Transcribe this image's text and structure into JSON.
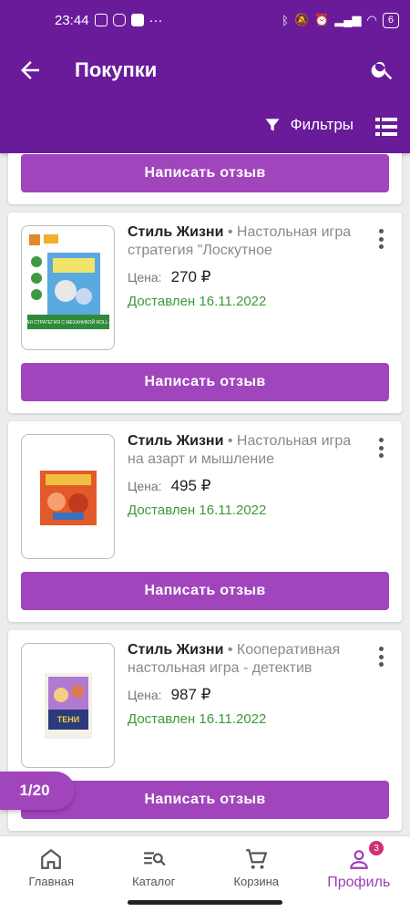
{
  "status_bar": {
    "time": "23:44",
    "battery": "6"
  },
  "header": {
    "title": "Покупки",
    "filters_label": "Фильтры"
  },
  "colors": {
    "primary": "#6a1b9a",
    "button": "#a145bd",
    "delivered": "#3a9a3a"
  },
  "orders": [
    {
      "brand": "Стиль Жизни",
      "description": "• Настольная игра стратегия \"Лоскутное",
      "price_label": "Цена:",
      "price": "270 ₽",
      "status": "Доставлен 16.11.2022",
      "review_label": "Написать отзыв",
      "thumb_text": "КОМПАКТНАЯ СТРАТЕГИЯ С МЕХАНИКОЙ ROLL-AND-WRITE"
    },
    {
      "brand": "Стиль Жизни",
      "description": "• Настольная игра на азарт и мышление",
      "price_label": "Цена:",
      "price": "495 ₽",
      "status": "Доставлен 16.11.2022",
      "review_label": "Написать отзыв"
    },
    {
      "brand": "Стиль Жизни",
      "description": "• Кооперативная настольная игра - детектив",
      "price_label": "Цена:",
      "price": "987 ₽",
      "status": "Доставлен 16.11.2022",
      "review_label": "Написать отзыв",
      "thumb_text": "ТЕНИ"
    }
  ],
  "top_review_label": "Написать отзыв",
  "pager": "1/20",
  "bottom_nav": [
    {
      "label": "Главная",
      "icon": "home-icon"
    },
    {
      "label": "Каталог",
      "icon": "catalog-search-icon"
    },
    {
      "label": "Корзина",
      "icon": "cart-icon"
    },
    {
      "label": "Профиль",
      "icon": "profile-icon",
      "badge": "3",
      "active": true
    }
  ]
}
